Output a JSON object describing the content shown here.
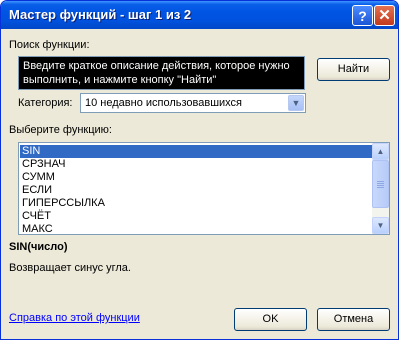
{
  "window": {
    "title": "Мастер функций - шаг 1 из 2",
    "help_glyph": "?",
    "close_glyph": "✕"
  },
  "search": {
    "label": "Поиск функции:",
    "description_text": "Введите краткое описание действия, которое нужно выполнить, и нажмите кнопку \"Найти\"",
    "find_button": "Найти"
  },
  "category": {
    "label": "Категория:",
    "selected": "10 недавно использовавшихся"
  },
  "function_list": {
    "label": "Выберите функцию:",
    "items": [
      "SIN",
      "СРЗНАЧ",
      "СУММ",
      "ЕСЛИ",
      "ГИПЕРССЫЛКА",
      "СЧЁТ",
      "МАКС"
    ],
    "selected_index": 0
  },
  "selected_function": {
    "signature": "SIN(число)",
    "description": "Возвращает синус угла."
  },
  "footer": {
    "help_link": "Справка по этой функции",
    "ok_button": "OK",
    "cancel_button": "Отмена"
  }
}
